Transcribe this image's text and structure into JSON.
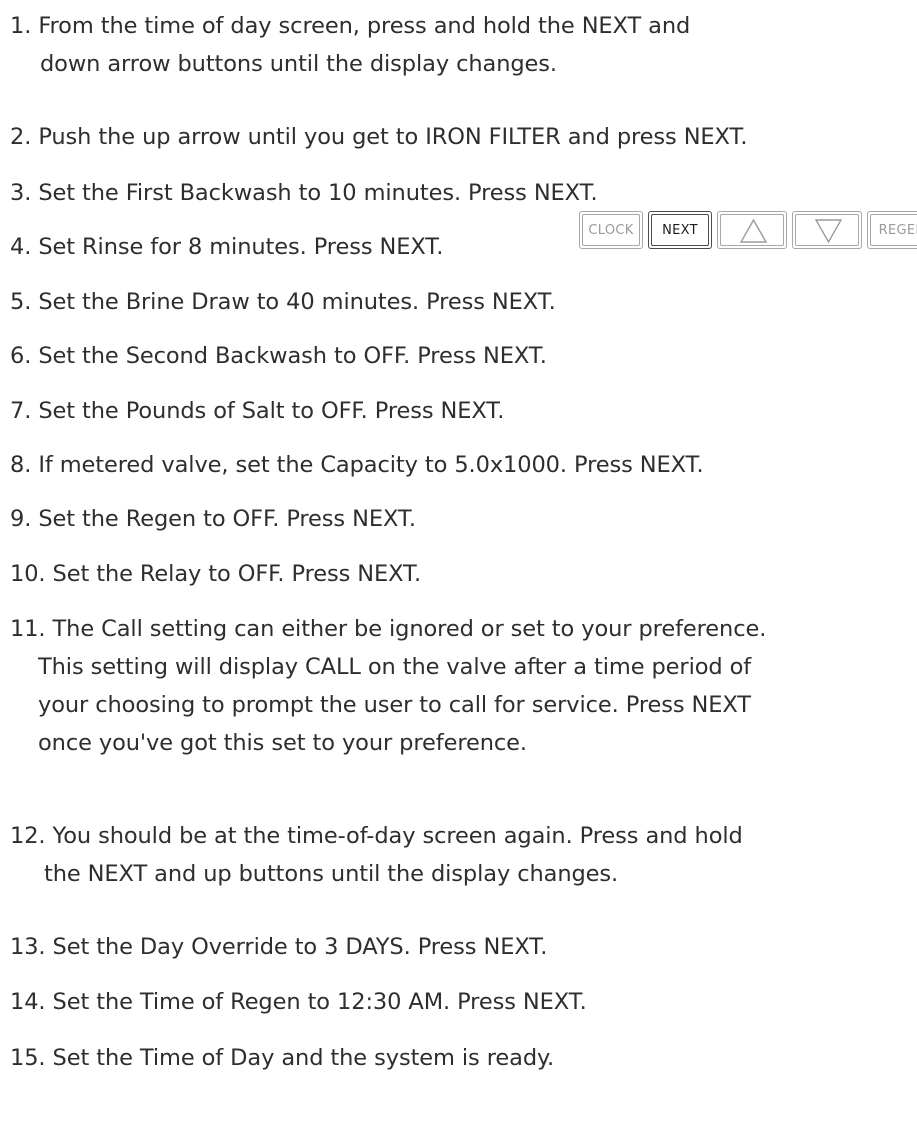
{
  "steps": [
    {
      "lines": [
        "1. From the time of day screen, press and hold the NEXT and",
        "down arrow buttons until the display changes."
      ]
    },
    {
      "lines": [
        "2. Push the up arrow until you get to IRON FILTER and press NEXT."
      ]
    },
    {
      "lines": [
        "3. Set the First Backwash to 10 minutes. Press NEXT."
      ]
    },
    {
      "lines": [
        "4. Set Rinse for 8 minutes. Press NEXT."
      ]
    },
    {
      "lines": [
        "5. Set the Brine Draw to 40 minutes. Press NEXT."
      ]
    },
    {
      "lines": [
        "6. Set the Second Backwash to OFF. Press NEXT."
      ]
    },
    {
      "lines": [
        "7. Set the Pounds of Salt to OFF. Press NEXT."
      ]
    },
    {
      "lines": [
        "8. If metered valve, set the Capacity to 5.0x1000. Press NEXT."
      ]
    },
    {
      "lines": [
        "9. Set the Regen to OFF. Press NEXT."
      ]
    },
    {
      "lines": [
        "10. Set the Relay to OFF. Press NEXT."
      ]
    },
    {
      "lines": [
        "11. The Call setting can either be ignored or set to your preference.",
        "This setting will display CALL on the valve after a time period of",
        "your choosing to prompt the user to call for service. Press NEXT",
        "once you've got this set to your preference."
      ]
    },
    {
      "lines": [
        "12. You should be at the time-of-day screen again. Press and hold",
        "the NEXT and up buttons until the display changes."
      ]
    },
    {
      "lines": [
        "13. Set the Day Override to 3 DAYS. Press NEXT."
      ]
    },
    {
      "lines": [
        "14. Set the Time of Regen to 12:30 AM. Press NEXT."
      ]
    },
    {
      "lines": [
        "15. Set the Time of Day and the system is ready."
      ]
    }
  ],
  "button_strip": {
    "buttons": [
      {
        "label": "CLOCK",
        "icon": null,
        "active": false
      },
      {
        "label": "NEXT",
        "icon": null,
        "active": true
      },
      {
        "label": "",
        "icon": "up-arrow-icon",
        "active": false
      },
      {
        "label": "",
        "icon": "down-arrow-icon",
        "active": false
      },
      {
        "label": "REGEN",
        "icon": null,
        "active": false
      }
    ],
    "colors": {
      "border": "#a8a8a8",
      "active_border": "#4a4a4a",
      "label": "#9a9a9a",
      "active_label": "#1e1e1e"
    }
  },
  "text_color": "#2e2e2e"
}
